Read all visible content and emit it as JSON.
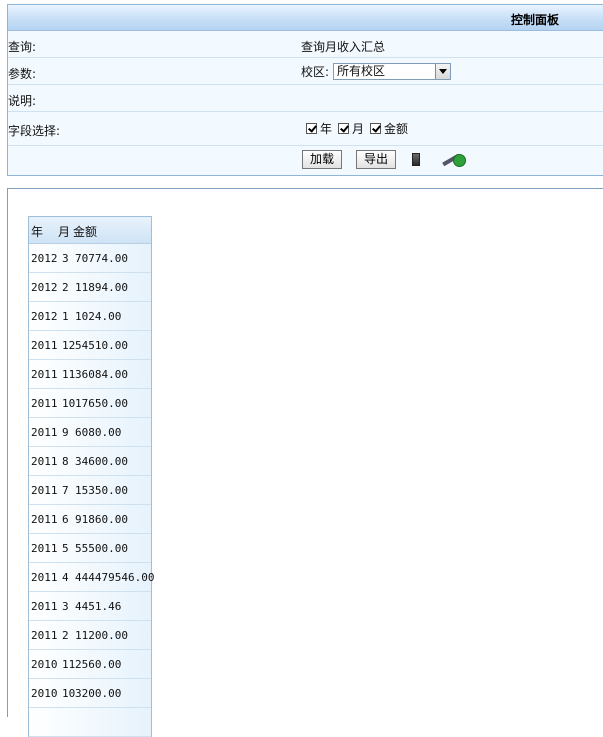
{
  "panel": {
    "title": "控制面板",
    "query_label": "查询:",
    "query_value": "查询月收入汇总",
    "param_label": "参数:",
    "campus_label": "校区:",
    "campus_selected": "所有校区",
    "desc_label": "说明:",
    "fields_label": "字段选择:",
    "fields": [
      {
        "label": "年",
        "checked": true
      },
      {
        "label": "月",
        "checked": true
      },
      {
        "label": "金额",
        "checked": true
      }
    ],
    "load_button": "加载",
    "export_button": "导出",
    "icons": [
      "excel-icon",
      "tool-icon"
    ]
  },
  "results": {
    "headers": {
      "year": "年",
      "month": "月",
      "amount": "金额"
    },
    "rows": [
      {
        "year": "2012",
        "month": "3",
        "amount": "70774.00"
      },
      {
        "year": "2012",
        "month": "2",
        "amount": "11894.00"
      },
      {
        "year": "2012",
        "month": "1",
        "amount": "1024.00"
      },
      {
        "year": "2011",
        "month": "12",
        "amount": "54510.00"
      },
      {
        "year": "2011",
        "month": "11",
        "amount": "36084.00"
      },
      {
        "year": "2011",
        "month": "10",
        "amount": "17650.00"
      },
      {
        "year": "2011",
        "month": "9",
        "amount": "6080.00"
      },
      {
        "year": "2011",
        "month": "8",
        "amount": "34600.00"
      },
      {
        "year": "2011",
        "month": "7",
        "amount": "15350.00"
      },
      {
        "year": "2011",
        "month": "6",
        "amount": "91860.00"
      },
      {
        "year": "2011",
        "month": "5",
        "amount": "55500.00"
      },
      {
        "year": "2011",
        "month": "4",
        "amount": "444479546.00"
      },
      {
        "year": "2011",
        "month": "3",
        "amount": "4451.46"
      },
      {
        "year": "2011",
        "month": "2",
        "amount": "11200.00"
      },
      {
        "year": "2010",
        "month": "11",
        "amount": "2560.00"
      },
      {
        "year": "2010",
        "month": "10",
        "amount": "3200.00"
      }
    ]
  }
}
